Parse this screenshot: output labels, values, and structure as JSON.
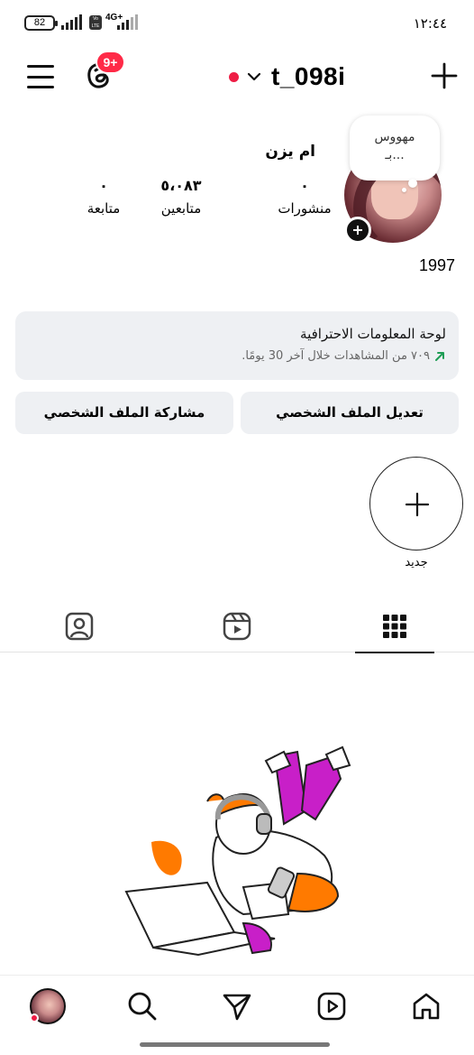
{
  "status_bar": {
    "battery": "82",
    "volte": "Vo LTE",
    "network": "4G+",
    "time": "١٢:٤٤"
  },
  "header": {
    "notification_badge": "9+",
    "username": "t_098i"
  },
  "profile": {
    "note_line1": "مهووس",
    "note_line2": "بـ...",
    "display_name": "ام يزن",
    "stats": {
      "posts_value": "٠",
      "posts_label": "منشورات",
      "followers_value": "٥،٠٨٣",
      "followers_label": "متابعين",
      "following_value": "٠",
      "following_label": "متابعة"
    },
    "bio": "1997"
  },
  "dashboard": {
    "title": "لوحة المعلومات الاحترافية",
    "subtitle": "٧٠٩ من المشاهدات خلال آخر 30 يومًا.",
    "trend_color": "#1f9d55"
  },
  "actions": {
    "edit_label": "تعديل الملف الشخصي",
    "share_label": "مشاركة الملف الشخصي"
  },
  "highlights": {
    "new_label": "جديد"
  },
  "tabs": {
    "active": "grid",
    "items": [
      "grid-icon",
      "reels-icon",
      "tagged-icon"
    ]
  },
  "colors": {
    "accent_red": "#ee1d45",
    "card_bg": "#eef0f3",
    "illustration_orange": "#ff7a00",
    "illustration_magenta": "#c81fc8"
  }
}
